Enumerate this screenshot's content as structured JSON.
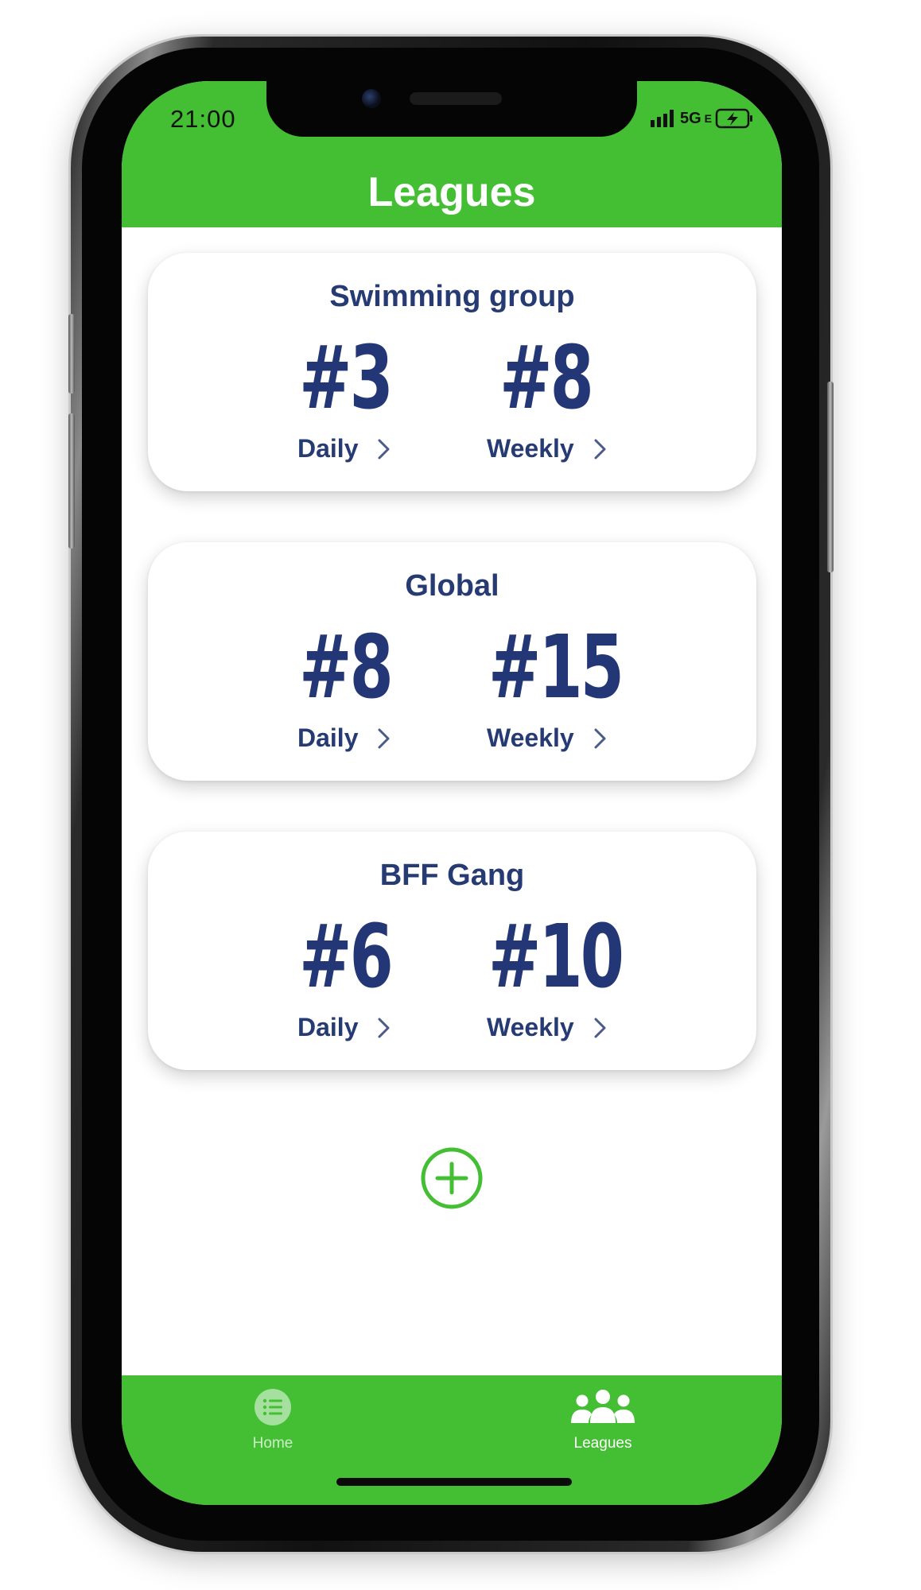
{
  "status_bar": {
    "time": "21:00",
    "network": "5G",
    "network_suffix": "E"
  },
  "header": {
    "title": "Leagues"
  },
  "leagues": [
    {
      "name": "Swimming group",
      "daily_rank": "#3",
      "weekly_rank": "#8",
      "daily_label": "Daily",
      "weekly_label": "Weekly"
    },
    {
      "name": "Global",
      "daily_rank": "#8",
      "weekly_rank": "#15",
      "daily_label": "Daily",
      "weekly_label": "Weekly"
    },
    {
      "name": "BFF Gang",
      "daily_rank": "#6",
      "weekly_rank": "#10",
      "daily_label": "Daily",
      "weekly_label": "Weekly"
    }
  ],
  "tabbar": {
    "items": [
      {
        "label": "Home",
        "icon": "list-icon",
        "active": false
      },
      {
        "label": "Leagues",
        "icon": "people-group-icon",
        "active": true
      }
    ]
  },
  "colors": {
    "brand_green": "#44bf34",
    "navy": "#263a73",
    "tab_inactive": "#a6e09f"
  }
}
